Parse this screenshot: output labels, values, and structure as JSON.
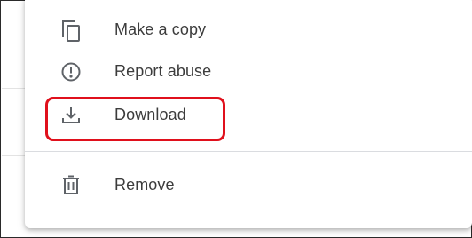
{
  "menu": {
    "items": [
      {
        "label": "Make a copy",
        "icon": "copy-icon"
      },
      {
        "label": "Report abuse",
        "icon": "report-icon"
      },
      {
        "label": "Download",
        "icon": "download-icon",
        "highlighted": true
      },
      {
        "label": "Remove",
        "icon": "trash-icon"
      }
    ]
  },
  "colors": {
    "icon": "#5f6368",
    "text": "#3c3c3c",
    "highlight": "#e0101c",
    "divider": "#dadce0"
  }
}
